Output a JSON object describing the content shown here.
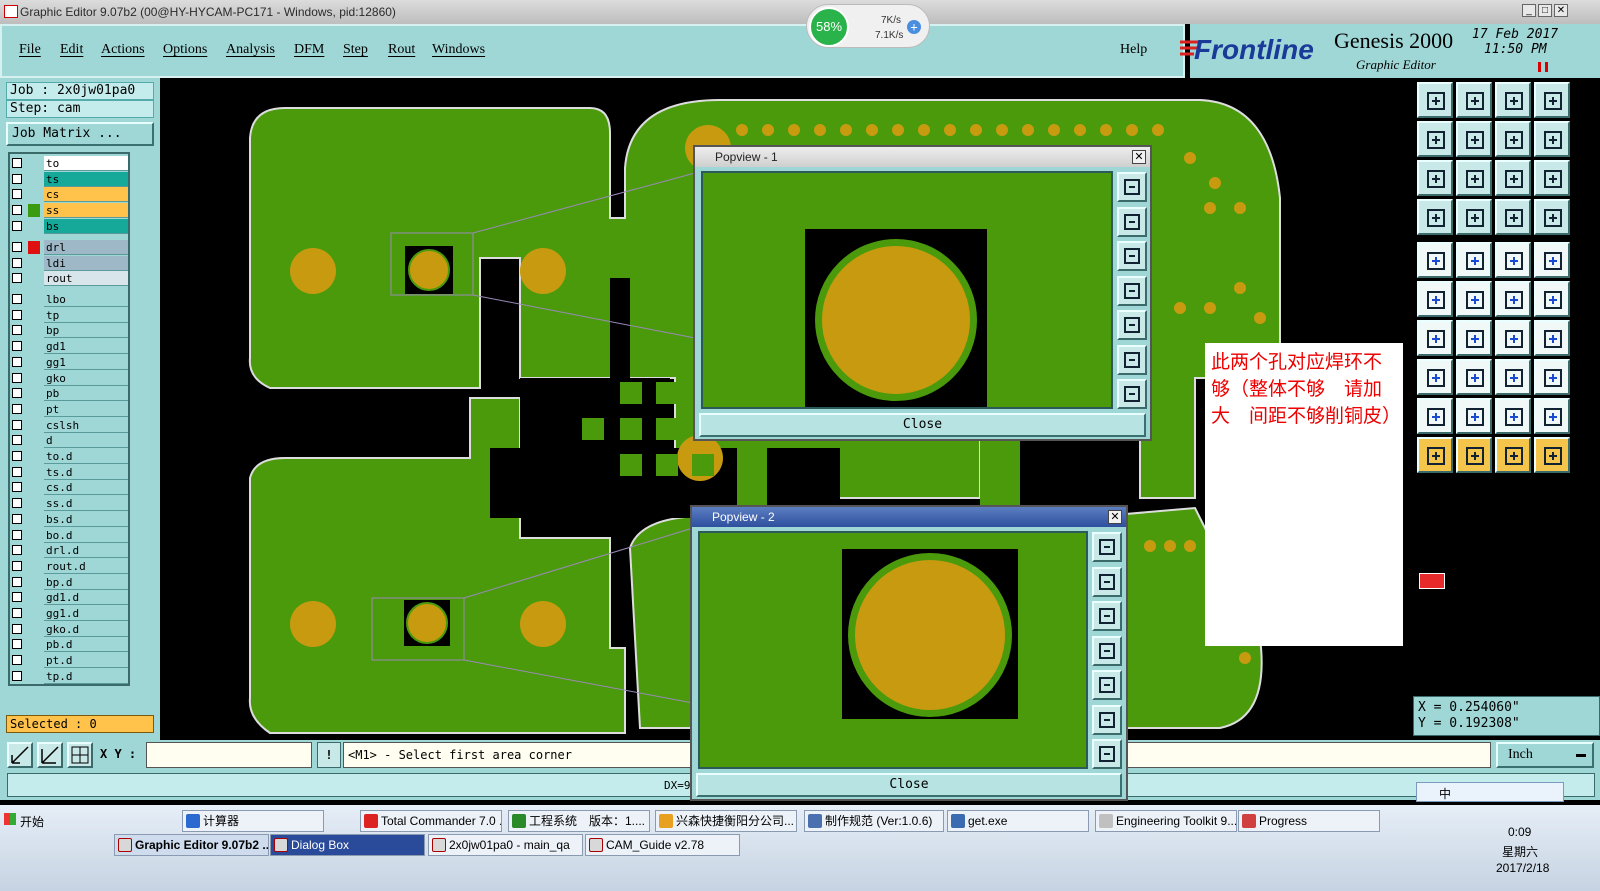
{
  "window": {
    "title": "Graphic Editor 9.07b2 (00@HY-HYCAM-PC171 - Windows, pid:12860)",
    "min_label": "_",
    "max_label": "□",
    "close_label": "✕"
  },
  "netmeter": {
    "percent": "58%",
    "up": "7K/s",
    "down": "7.1K/s",
    "plus": "+"
  },
  "menu": {
    "items": [
      "File",
      "Edit",
      "Actions",
      "Options",
      "Analysis",
      "DFM",
      "Step",
      "Rout",
      "Windows"
    ],
    "help": "Help"
  },
  "brand": {
    "logo": "Frontline",
    "product": "Genesis 2000",
    "subtitle": "Graphic Editor",
    "date": "17 Feb 2017",
    "time": "11:50 PM"
  },
  "job": {
    "job_label": "Job : 2x0jw01pa0",
    "step_label": "Step: cam",
    "matrix_button": "Job Matrix ..."
  },
  "layers_group1": [
    {
      "name": "to",
      "color": "#ffffff",
      "sw": ""
    },
    {
      "name": "ts",
      "color": "#16a99a",
      "sw": ""
    },
    {
      "name": "cs",
      "color": "#ffc24a",
      "sw": ""
    },
    {
      "name": "ss",
      "color": "#ffc24a",
      "sw": "#3a9a10"
    },
    {
      "name": "bs",
      "color": "#16a99a",
      "sw": ""
    }
  ],
  "layers_group2": [
    {
      "name": "drl",
      "color": "#9fb8c8",
      "sw": "#e01010"
    },
    {
      "name": "ldi",
      "color": "#9fb8c8",
      "sw": ""
    },
    {
      "name": "rout",
      "color": "#d8e6ec",
      "sw": ""
    }
  ],
  "layers_group3": [
    {
      "name": "lbo"
    },
    {
      "name": "tp"
    },
    {
      "name": "bp"
    },
    {
      "name": "gd1"
    },
    {
      "name": "gg1"
    },
    {
      "name": "gko"
    },
    {
      "name": "pb"
    },
    {
      "name": "pt"
    },
    {
      "name": "cslsh"
    },
    {
      "name": "d"
    },
    {
      "name": "to.d"
    },
    {
      "name": "ts.d"
    },
    {
      "name": "cs.d"
    },
    {
      "name": "ss.d"
    },
    {
      "name": "bs.d"
    },
    {
      "name": "bo.d"
    },
    {
      "name": "drl.d"
    },
    {
      "name": "rout.d"
    },
    {
      "name": "bp.d"
    },
    {
      "name": "gd1.d"
    },
    {
      "name": "gg1.d"
    },
    {
      "name": "gko.d"
    },
    {
      "name": "pb.d"
    },
    {
      "name": "pt.d"
    },
    {
      "name": "tp.d"
    }
  ],
  "status": {
    "selected": "Selected : 0",
    "xy_label": "X Y :",
    "xy_value": "",
    "prompt": "<M1> - Select first area corner",
    "units": "Inch",
    "dx_label": "DX=9",
    "coord_x": "X = 0.254060\"",
    "coord_y": "Y = 0.192308\""
  },
  "popview1": {
    "title": "Popview - 1",
    "close": "Close"
  },
  "popview2": {
    "title": "Popview - 2",
    "close": "Close"
  },
  "note": {
    "text": "此两个孔对应焊环不够（整体不够　请加大　间距不够削铜皮）"
  },
  "taskbar": {
    "start": "开始",
    "row1": [
      "计算器",
      "Total Commander 7.0 ...",
      "工程系统　版本：1....",
      "兴森快捷衡阳分公司...",
      "制作规范 (Ver:1.0.6)",
      "get.exe",
      "Engineering Toolkit 9....",
      "Progress"
    ],
    "row2": [
      "Graphic Editor 9.07b2 ...",
      "Dialog Box",
      "2x0jw01pa0 - main_qa",
      "CAM_Guide v2.78"
    ],
    "clock_time": "0:09",
    "clock_day": "星期六",
    "clock_date": "2017/2/18",
    "ime": "中"
  },
  "colors": {
    "panel": "#9fd6d6",
    "board": "#4a9a0c",
    "pad": "#c89a10"
  }
}
